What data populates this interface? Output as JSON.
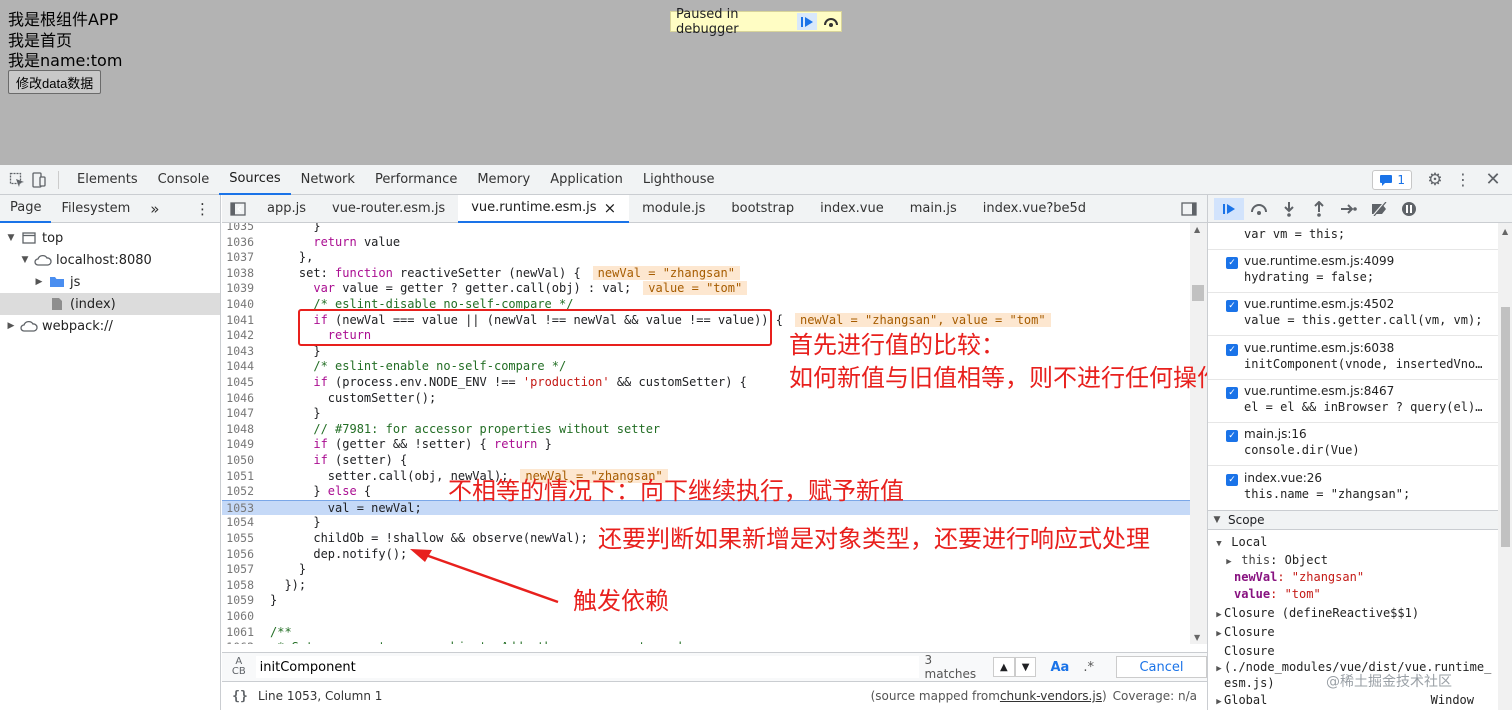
{
  "page": {
    "lines": [
      "我是根组件APP",
      "我是首页",
      "我是name:tom"
    ],
    "button_label": "修改data数据",
    "paused_label": "Paused in debugger"
  },
  "devtools": {
    "main_tabs": [
      "Elements",
      "Console",
      "Sources",
      "Network",
      "Performance",
      "Memory",
      "Application",
      "Lighthouse"
    ],
    "active_tab": "Sources",
    "issues_count": "1"
  },
  "navigator": {
    "tabs": [
      "Page",
      "Filesystem"
    ],
    "more": "»",
    "tree": [
      {
        "label": "top",
        "indent": 0,
        "tri": "▼",
        "icon": "window"
      },
      {
        "label": "localhost:8080",
        "indent": 1,
        "tri": "▼",
        "icon": "cloud"
      },
      {
        "label": "js",
        "indent": 2,
        "tri": "▶",
        "icon": "folder"
      },
      {
        "label": "(index)",
        "indent": 2,
        "tri": "",
        "icon": "file",
        "selected": true
      },
      {
        "label": "webpack://",
        "indent": 0,
        "tri": "▶",
        "icon": "cloud"
      }
    ]
  },
  "editor": {
    "file_tabs": [
      "app.js",
      "vue-router.esm.js",
      "vue.runtime.esm.js",
      "module.js",
      "bootstrap",
      "index.vue",
      "main.js",
      "index.vue?be5d"
    ],
    "active_file": "vue.runtime.esm.js",
    "close_glyph": "×",
    "lines": [
      {
        "n": "1035",
        "html": "      }"
      },
      {
        "n": "1036",
        "html": "      <span class=\"kw\">return</span> value"
      },
      {
        "n": "1037",
        "html": "    },"
      },
      {
        "n": "1038",
        "html": "    set: <span class=\"kw\">function</span> reactiveSetter (newVal) {",
        "inline": "newVal = \"zhangsan\""
      },
      {
        "n": "1039",
        "html": "      <span class=\"kw\">var</span> value = getter ? getter.call(obj) : val;",
        "inline": "value = \"tom\""
      },
      {
        "n": "1040",
        "html": "      <span class=\"cm\">/* eslint-disable no-self-compare */</span>"
      },
      {
        "n": "1041",
        "html": "      <span class=\"kw\">if</span> (newVal === value || (newVal !== newVal &amp;&amp; value !== value)) {",
        "inline": "newVal = \"zhangsan\", value = \"tom\""
      },
      {
        "n": "1042",
        "html": "        <span class=\"kw\">return</span>"
      },
      {
        "n": "1043",
        "html": "      }"
      },
      {
        "n": "1044",
        "html": "      <span class=\"cm\">/* eslint-enable no-self-compare */</span>"
      },
      {
        "n": "1045",
        "html": "      <span class=\"kw\">if</span> (process.env.NODE_ENV !== <span class=\"str\">'production'</span> &amp;&amp; customSetter) {"
      },
      {
        "n": "1046",
        "html": "        customSetter();"
      },
      {
        "n": "1047",
        "html": "      }"
      },
      {
        "n": "1048",
        "html": "      <span class=\"cm\">// #7981: for accessor properties without setter</span>"
      },
      {
        "n": "1049",
        "html": "      <span class=\"kw\">if</span> (getter &amp;&amp; !setter) { <span class=\"kw\">return</span> }"
      },
      {
        "n": "1050",
        "html": "      <span class=\"kw\">if</span> (setter) {"
      },
      {
        "n": "1051",
        "html": "        setter.call(obj, newVal);",
        "inline": "newVal = \"zhangsan\""
      },
      {
        "n": "1052",
        "html": "      } <span class=\"kw\">else</span> {"
      },
      {
        "n": "1053",
        "html": "        val = newVal;",
        "highlight": true
      },
      {
        "n": "1054",
        "html": "      }"
      },
      {
        "n": "1055",
        "html": "      childOb = !shallow &amp;&amp; observe(newVal);"
      },
      {
        "n": "1056",
        "html": "      dep.notify();"
      },
      {
        "n": "1057",
        "html": "    }"
      },
      {
        "n": "1058",
        "html": "  });"
      },
      {
        "n": "1059",
        "html": "}"
      },
      {
        "n": "1060",
        "html": ""
      },
      {
        "n": "1061",
        "html": "<span class=\"cm\">/**</span>"
      },
      {
        "n": "1062",
        "html": "<span class=\"cm\"> * Set a property on an object. Adds the new property and</span>"
      }
    ]
  },
  "annotations": {
    "a1_line1": "首先进行值的比较：",
    "a1_line2": "如何新值与旧值相等，则不进行任何操作",
    "a2": "不相等的情况下：向下继续执行，赋予新值",
    "a3": "还要判断如果新增是对象类型，还要进行响应式处理",
    "a4": "触发依赖"
  },
  "search": {
    "value": "initComponent",
    "matches": "3 matches",
    "match_case": "Aa",
    "regex": ".*",
    "cancel": "Cancel"
  },
  "status": {
    "position": "Line 1053, Column 1",
    "source_mapped_prefix": "(source mapped from ",
    "source_file": "chunk-vendors.js",
    "source_mapped_suffix": ")",
    "coverage": "Coverage: n/a"
  },
  "debugger": {
    "call_stack": [
      {
        "file": "",
        "code": "var vm = this;"
      },
      {
        "file": "vue.runtime.esm.js:4099",
        "code": "hydrating = false;"
      },
      {
        "file": "vue.runtime.esm.js:4502",
        "code": "value = this.getter.call(vm, vm);"
      },
      {
        "file": "vue.runtime.esm.js:6038",
        "code": "initComponent(vnode, insertedVno…"
      },
      {
        "file": "vue.runtime.esm.js:8467",
        "code": "el = el && inBrowser ? query(el)…"
      },
      {
        "file": "main.js:16",
        "code": "console.dir(Vue)"
      },
      {
        "file": "index.vue:26",
        "code": "this.name = \"zhangsan\";"
      }
    ],
    "scope_title": "Scope",
    "local_title": "Local",
    "this_label": "this",
    "this_value": ": Object",
    "newval_key": "newVal",
    "newval_value": ": \"zhangsan\"",
    "value_key": "value",
    "value_value": ": \"tom\"",
    "closure1": "Closure (defineReactive$$1)",
    "closure2": "Closure",
    "closure3_line1": "Closure",
    "closure3_line2": "(./node_modules/vue/dist/vue.runtime_",
    "closure3_line3": "esm.js)",
    "global": "Global",
    "global_value": "Window"
  },
  "watermark": "@稀土掘金技术社区"
}
